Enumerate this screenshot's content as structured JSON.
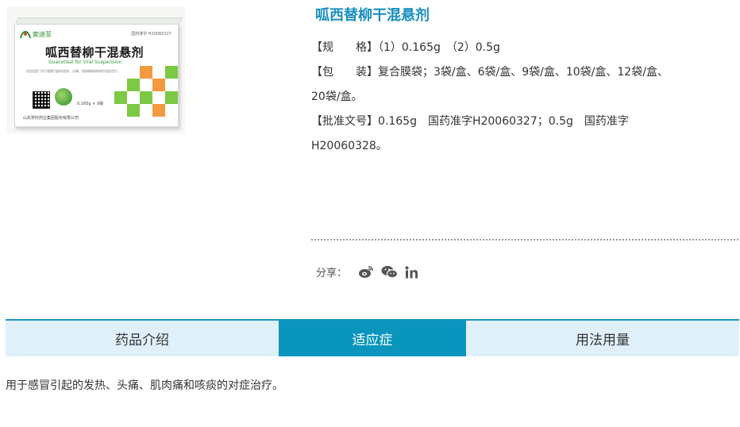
{
  "product": {
    "title": "呱西替柳干混悬剂",
    "image": {
      "box_title": "呱西替柳干混悬剂",
      "box_subtitle": "Guacetisal for Oral Suspension",
      "brand": "索迪菲",
      "code": "国药准字 H20060327",
      "dose": "0.165g × 9袋",
      "maker": "山东罗欣药业集团股份有限公司",
      "note": "【适应症】用于感冒引起的发热、头痛、肌肉痛和咳痰的对症治疗。"
    }
  },
  "specs": {
    "spec_label": "【规　　格】",
    "spec_value": "（1）0.165g　（2）0.5g",
    "pack_label": "【包　　装】",
    "pack_value_1": "复合膜袋；3袋/盒、6袋/盒、9袋/盒、10袋/盒、12袋/盒、",
    "pack_value_2": "20袋/盒。",
    "approval_label": "【批准文号】",
    "approval_value_1": "0.165g　国药准字H20060327；0.5g　国药准字",
    "approval_value_2": "H20060328。"
  },
  "share": {
    "label": "分享：",
    "icons": [
      "weibo-icon",
      "wechat-icon",
      "linkedin-icon"
    ]
  },
  "tabs": [
    {
      "label": "药品介绍",
      "active": false
    },
    {
      "label": "适应症",
      "active": true
    },
    {
      "label": "用法用量",
      "active": false
    }
  ],
  "content": {
    "text": "用于感冒引起的发热、头痛、肌肉痛和咳痰的对症治疗。"
  },
  "colors": {
    "accent": "#0a95bd",
    "title": "#1a8fbf",
    "tab_bg": "#dff0fb"
  }
}
